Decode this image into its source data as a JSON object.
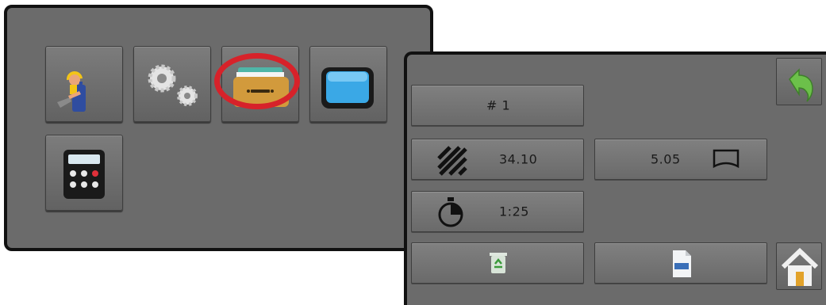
{
  "job_panel": {
    "job_label": "# 1",
    "area_value": "34.10",
    "volume_value": "5.05",
    "time_value": "1:25"
  },
  "icons": {
    "tools": [
      "worker-icon",
      "gears-icon",
      "job-folder-icon",
      "display-icon",
      "calculator-icon"
    ],
    "job": [
      "back-arrow-icon",
      "area-hatch-icon",
      "tank-volume-icon",
      "stopwatch-icon",
      "recycle-bin-icon",
      "report-file-icon",
      "home-icon"
    ]
  },
  "colors": {
    "panel": "#6b6b6b",
    "highlight": "#d7222a",
    "back_arrow": "#6cc04a"
  }
}
